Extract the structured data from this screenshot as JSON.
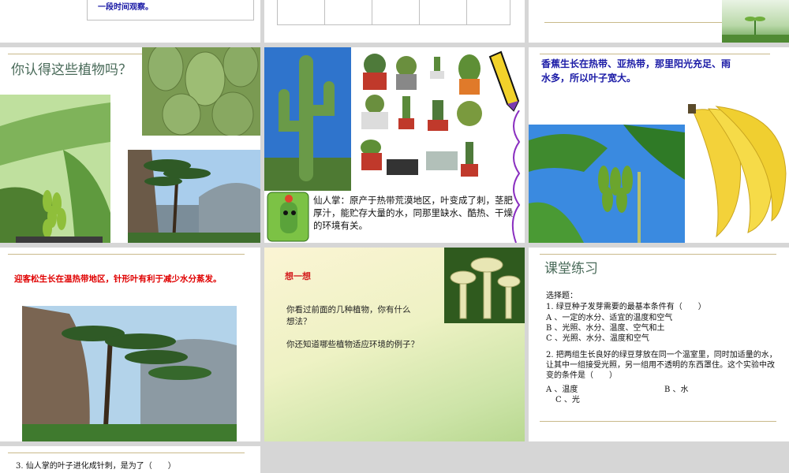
{
  "colors": {
    "title_green": "#2e7d5b",
    "title_gray": "#4a6b5a",
    "blue_text": "#1a1aa6",
    "red_text": "#e00000",
    "dark_text": "#111111",
    "accent_red": "#d42020"
  },
  "slide1": {
    "note": "一段时间观察。"
  },
  "slide4": {
    "title": "你认得这些植物吗？"
  },
  "slide5": {
    "caption": "仙人掌：原产于热带荒漠地区，叶变成了刺，茎肥厚汁，能贮存大量的水，同那里缺水、酷热、干燥的环境有关。"
  },
  "slide6": {
    "caption": "香蕉生长在热带、亚热带，那里阳光充足、雨水多，所以叶子宽大。"
  },
  "slide7": {
    "caption": "迎客松生长在温热带地区，针形叶有利于减少水分蒸发。"
  },
  "slide8": {
    "title": "想一想",
    "q1": "你看过前面的几种植物，你有什么想法？",
    "q2": "你还知道哪些植物适应环境的例子？"
  },
  "slide9": {
    "title": "课堂练习",
    "heading": "选择题：",
    "q1": "1. 绿豆种子发芽需要的最基本条件有（　　）",
    "q1_a": "A 、一定的水分、适宜的温度和空气",
    "q1_b": "B 、光照、水分、温度、空气和土",
    "q1_c": "C 、光照、水分、温度和空气",
    "q2": "2. 把两组生长良好的绿豆芽放在同一个温室里，同时加适量的水，让其中一组接受光照，另一组用不透明的东西罩住。这个实验中改变的条件是（　　）",
    "q2_a": "A 、温度",
    "q2_b": "B 、水",
    "q2_c": "C 、光"
  },
  "slide10": {
    "q3": "3. 仙人掌的叶子进化成针刺，是为了（　　）"
  }
}
